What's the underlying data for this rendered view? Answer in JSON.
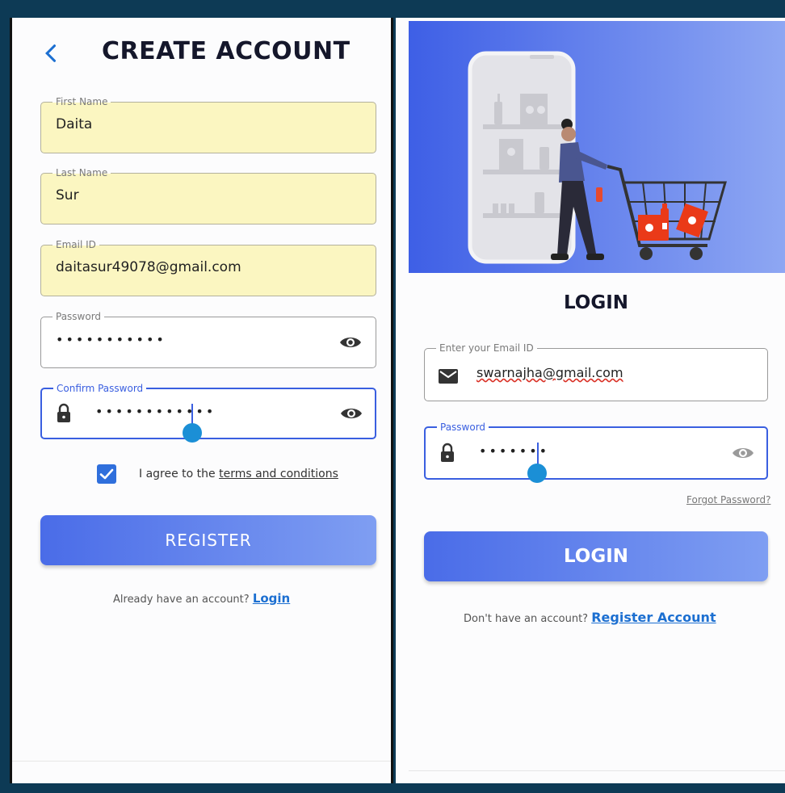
{
  "register": {
    "title": "CREATE ACCOUNT",
    "first_name": {
      "label": "First Name",
      "value": "Daita"
    },
    "last_name": {
      "label": "Last Name",
      "value": "Sur"
    },
    "email": {
      "label": "Email ID",
      "value": "daitasur49078@gmail.com"
    },
    "password": {
      "label": "Password",
      "value": "•••••••••••"
    },
    "confirm_password": {
      "label": "Confirm Password",
      "value": "••••••••••••"
    },
    "agree_prefix": "I agree to the ",
    "agree_link": "terms and conditions",
    "register_button": "REGISTER",
    "footer_text": "Already have an account?",
    "footer_link": "Login"
  },
  "login": {
    "title": "LOGIN",
    "email": {
      "label": "Enter your Email ID",
      "value": "swarnajha@gmail.com"
    },
    "password": {
      "label": "Password",
      "value": "•••••••"
    },
    "forgot": "Forgot Password?",
    "login_button": "LOGIN",
    "footer_text": "Don't have an account?",
    "footer_link": "Register Account"
  },
  "colors": {
    "accent": "#3a5fe0",
    "filled_field": "#fbf6c1",
    "link": "#1c6fd1",
    "background": "#0d3a55"
  },
  "icons": [
    "back-icon",
    "eye-icon",
    "lock-icon",
    "checkbox-checked-icon",
    "mail-icon",
    "shopping-illustration"
  ]
}
